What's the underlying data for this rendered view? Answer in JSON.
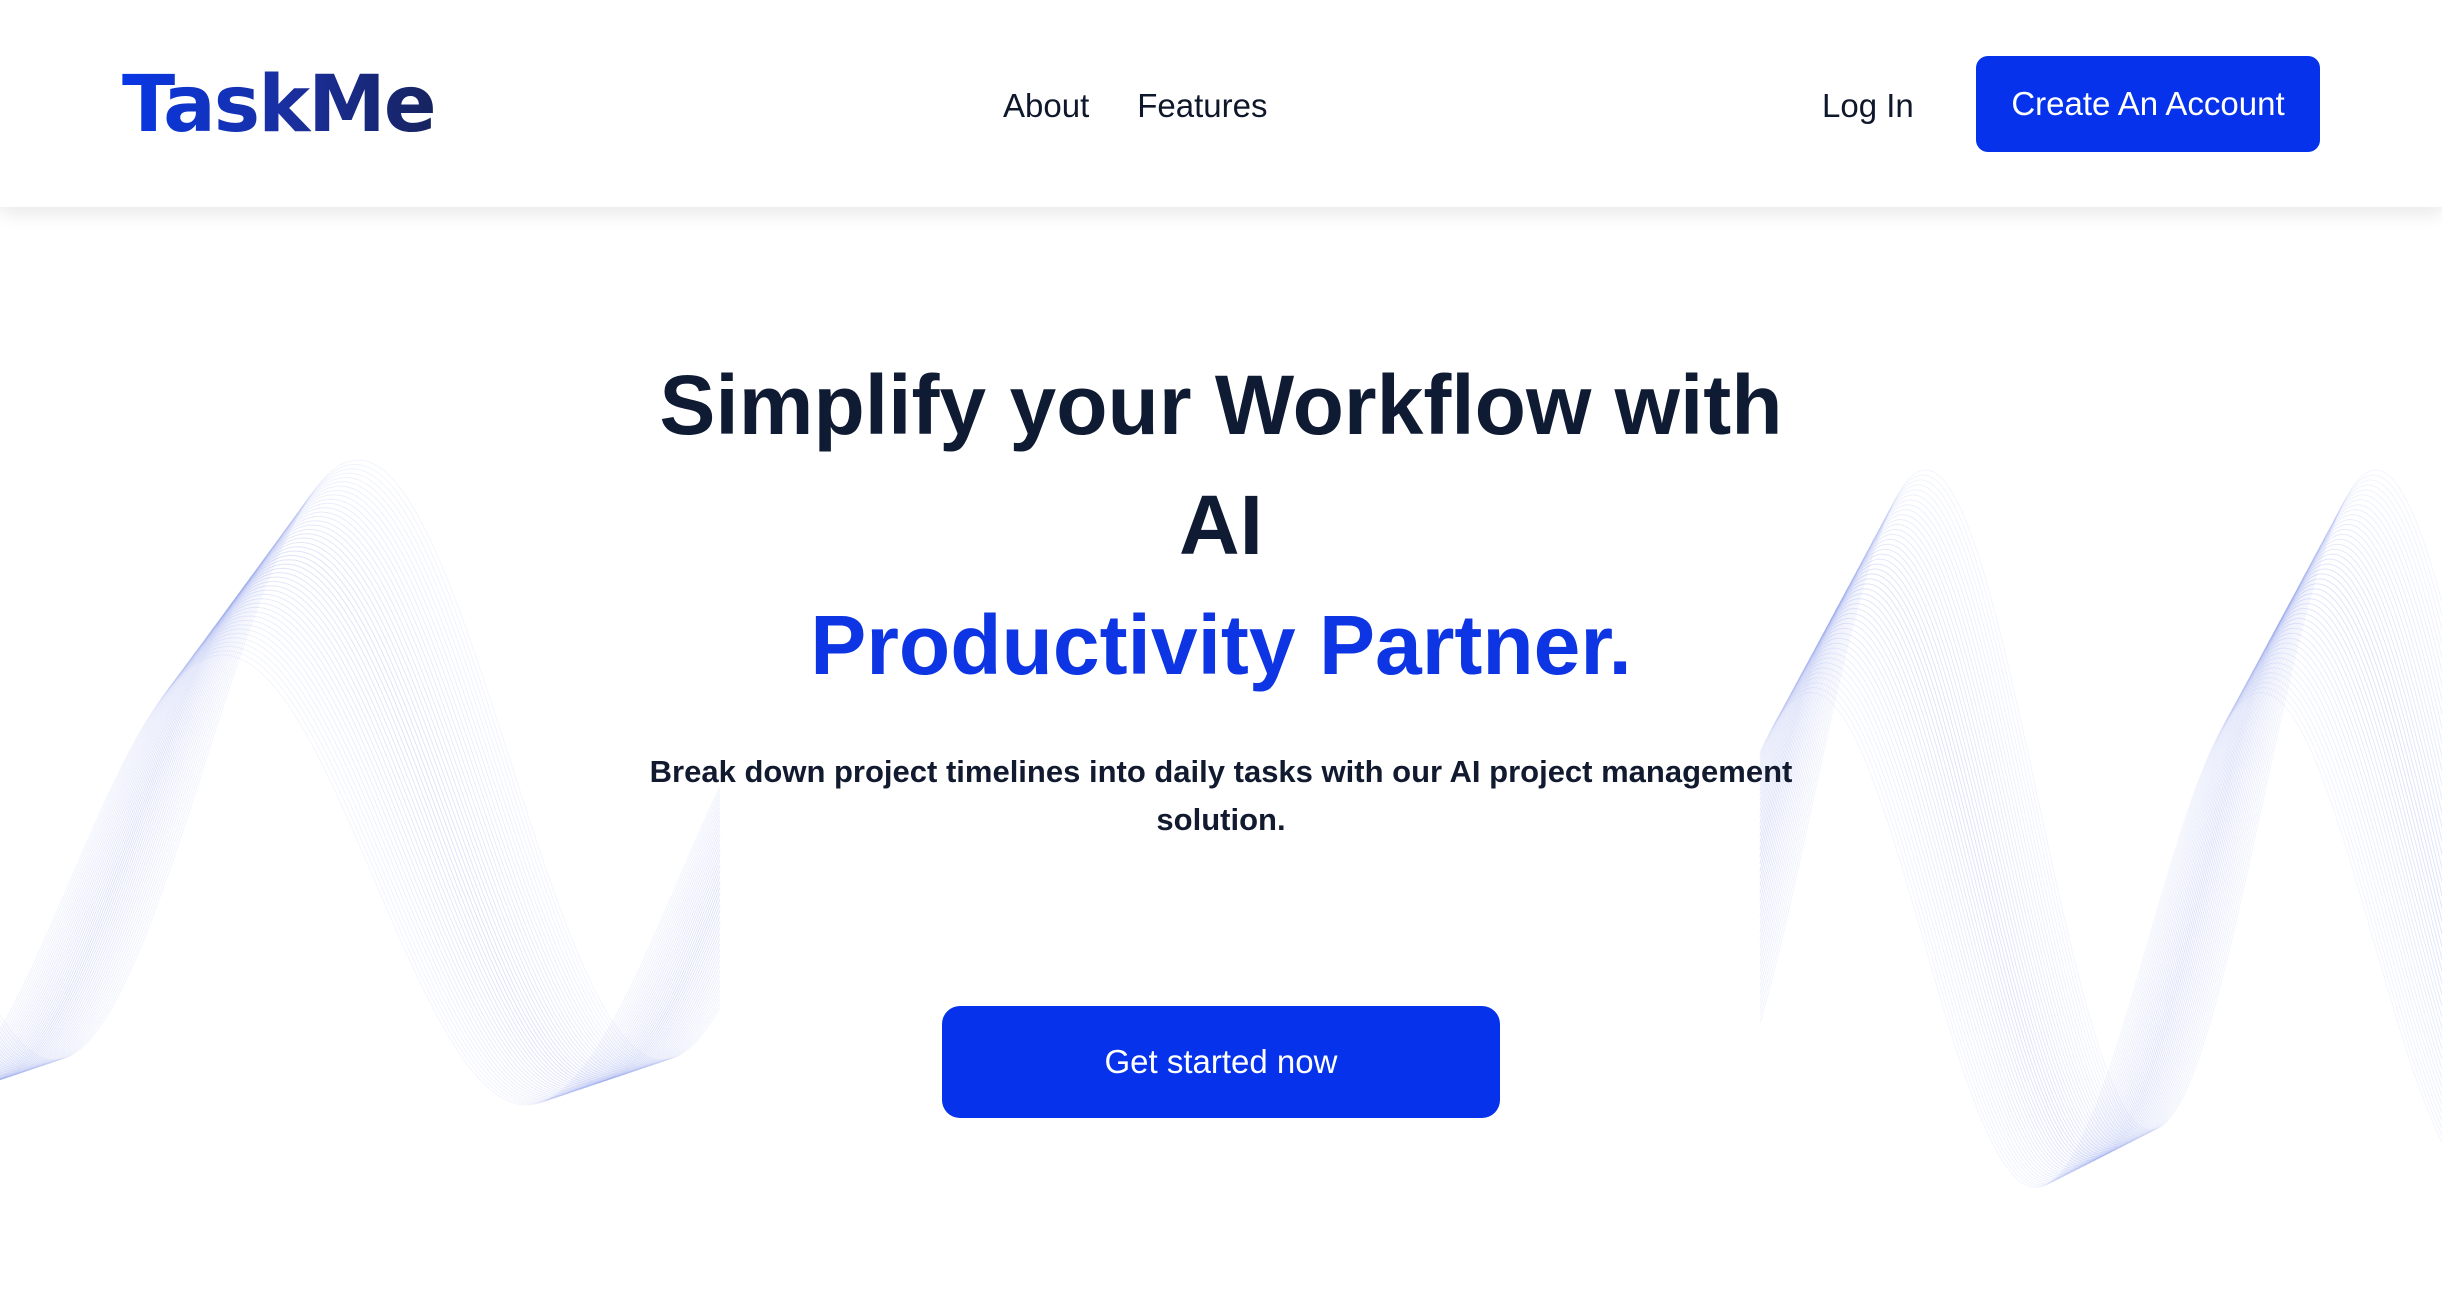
{
  "header": {
    "logo_text": "TaskMe",
    "nav": [
      {
        "label": "About"
      },
      {
        "label": "Features"
      }
    ],
    "login_label": "Log In",
    "signup_label": "Create An Account"
  },
  "hero": {
    "title_line1": "Simplify your Workflow with",
    "title_line2": "AI",
    "title_highlight": "Productivity Partner.",
    "subtitle": "Break down project timelines into daily tasks with our AI project management solution.",
    "cta_label": "Get started now"
  },
  "colors": {
    "brand": "#0532ea",
    "heading": "#0f1b33",
    "highlight": "#0d35e3",
    "wave": "#8a9bea"
  }
}
